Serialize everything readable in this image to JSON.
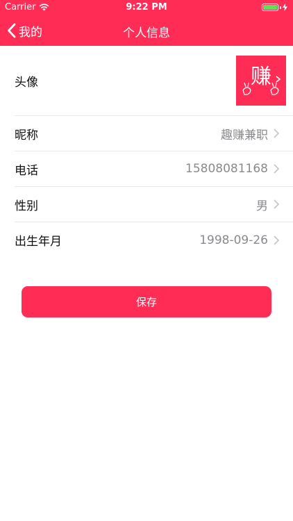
{
  "status_bar": {
    "carrier": "Carrier",
    "time": "9:22 PM",
    "battery_level": 100,
    "battery_color": "#5ee05a"
  },
  "nav": {
    "back_label": "我的",
    "title": "个人信息",
    "back_icon": "chevron-left-icon"
  },
  "theme": {
    "accent": "#ff2d55",
    "value_gray": "#8a8a8e",
    "divider": "#e6e6e6"
  },
  "profile": {
    "avatar_label": "头像",
    "avatar_glyph": "赚",
    "rows": [
      {
        "label": "昵称",
        "value": "趣赚兼职"
      },
      {
        "label": "电话",
        "value": "15808081168"
      },
      {
        "label": "性别",
        "value": "男"
      },
      {
        "label": "出生年月",
        "value": "1998-09-26"
      }
    ]
  },
  "actions": {
    "save_label": "保存"
  }
}
